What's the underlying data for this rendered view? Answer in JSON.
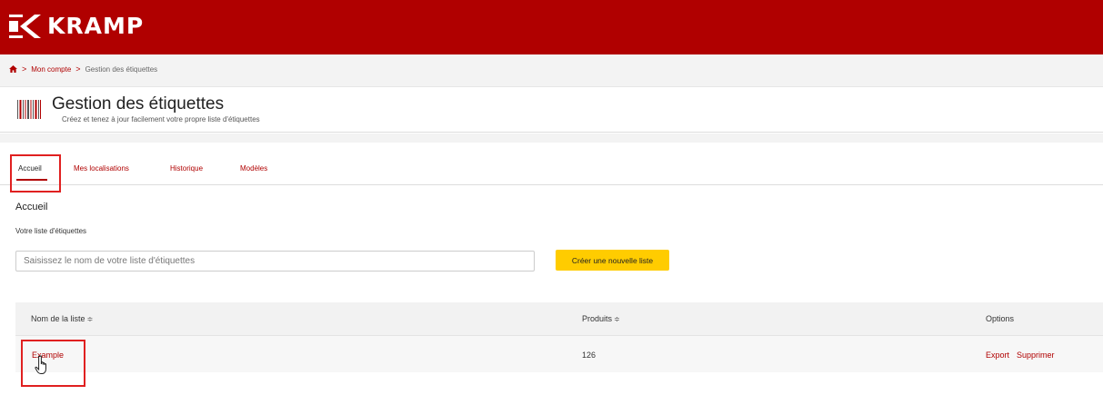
{
  "brand": {
    "name": "KRAMP",
    "color": "#b00000"
  },
  "breadcrumb": {
    "home_icon": "home-icon",
    "items": [
      "Mon compte",
      "Gestion des étiquettes"
    ],
    "separator": ">"
  },
  "header": {
    "icon": "barcode-icon",
    "title": "Gestion des étiquettes",
    "subtitle": "Créez et tenez à jour facilement votre propre liste d'étiquettes"
  },
  "tabs": [
    {
      "label": "Accueil",
      "active": true
    },
    {
      "label": "Mes localisations",
      "active": false
    },
    {
      "label": "Historique",
      "active": false
    },
    {
      "label": "Modèles",
      "active": false
    }
  ],
  "main": {
    "section_title": "Accueil",
    "field_label": "Votre liste d'étiquettes",
    "input": {
      "value": "",
      "placeholder": "Saisissez le nom de votre liste d'étiquettes"
    },
    "create_button": "Créer une nouvelle liste",
    "accent": "#ffcc00"
  },
  "table": {
    "sort_glyph": "≑",
    "columns": [
      "Nom de la liste",
      "Produits",
      "Options"
    ],
    "rows": [
      {
        "name": "Example",
        "products": "126",
        "options": [
          "Export",
          "Supprimer"
        ]
      }
    ]
  }
}
